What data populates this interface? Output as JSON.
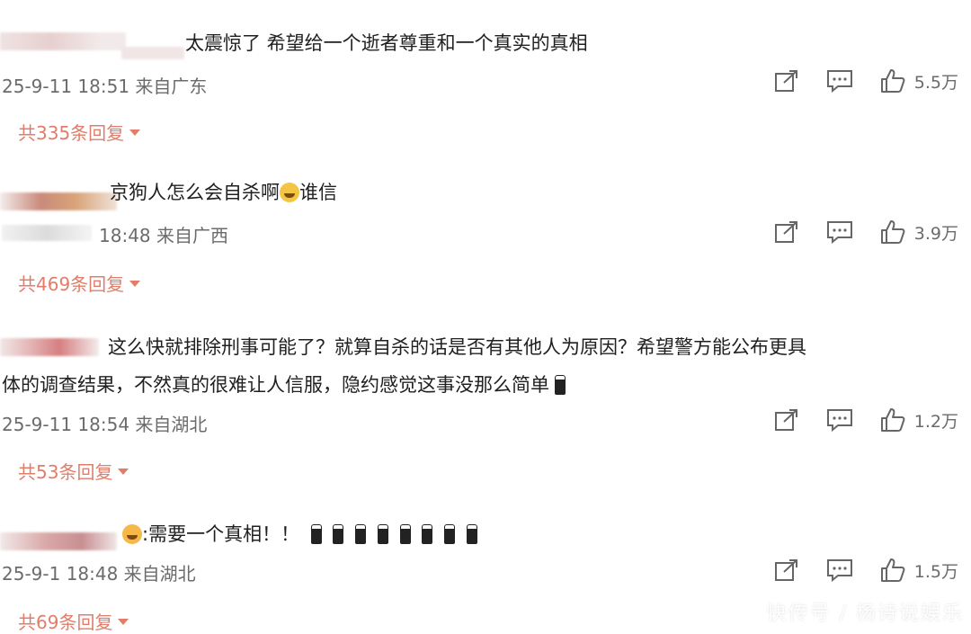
{
  "comments": [
    {
      "text_lines": [
        "太震惊了 希望给一个逝者尊重和一个真实的真相"
      ],
      "meta": "25-9-11 18:51 来自广东",
      "likes": "5.5万",
      "replies": "共335条回复",
      "emoji_count": 0
    },
    {
      "text_lines": [
        "京狗人怎么会自杀啊",
        "谁信"
      ],
      "meta": "18:48 来自广西",
      "likes": "3.9万",
      "replies": "共469条回复",
      "emoji_count": 0
    },
    {
      "text_lines": [
        "这么快就排除刑事可能了？就算自杀的话是否有其他人为原因？希望警方能公布更具",
        "体的调查结果，不然真的很难让人信服，隐约感觉这事没那么简单"
      ],
      "meta": "25-9-11 18:54 来自湖北",
      "likes": "1.2万",
      "replies": "共53条回复",
      "emoji_count": 1
    },
    {
      "text_lines": [
        ":需要一个真相！！"
      ],
      "meta": "25-9-1 18:48 来自湖北",
      "likes": "1.5万",
      "replies": "共69条回复",
      "emoji_count": 8
    }
  ],
  "icons": [
    "share-icon",
    "comment-icon",
    "like-icon"
  ],
  "colors": {
    "reply_accent": "#e07d6b",
    "meta_gray": "#6b6b6b"
  },
  "watermark": "快传号 / 杨诗说娱乐"
}
